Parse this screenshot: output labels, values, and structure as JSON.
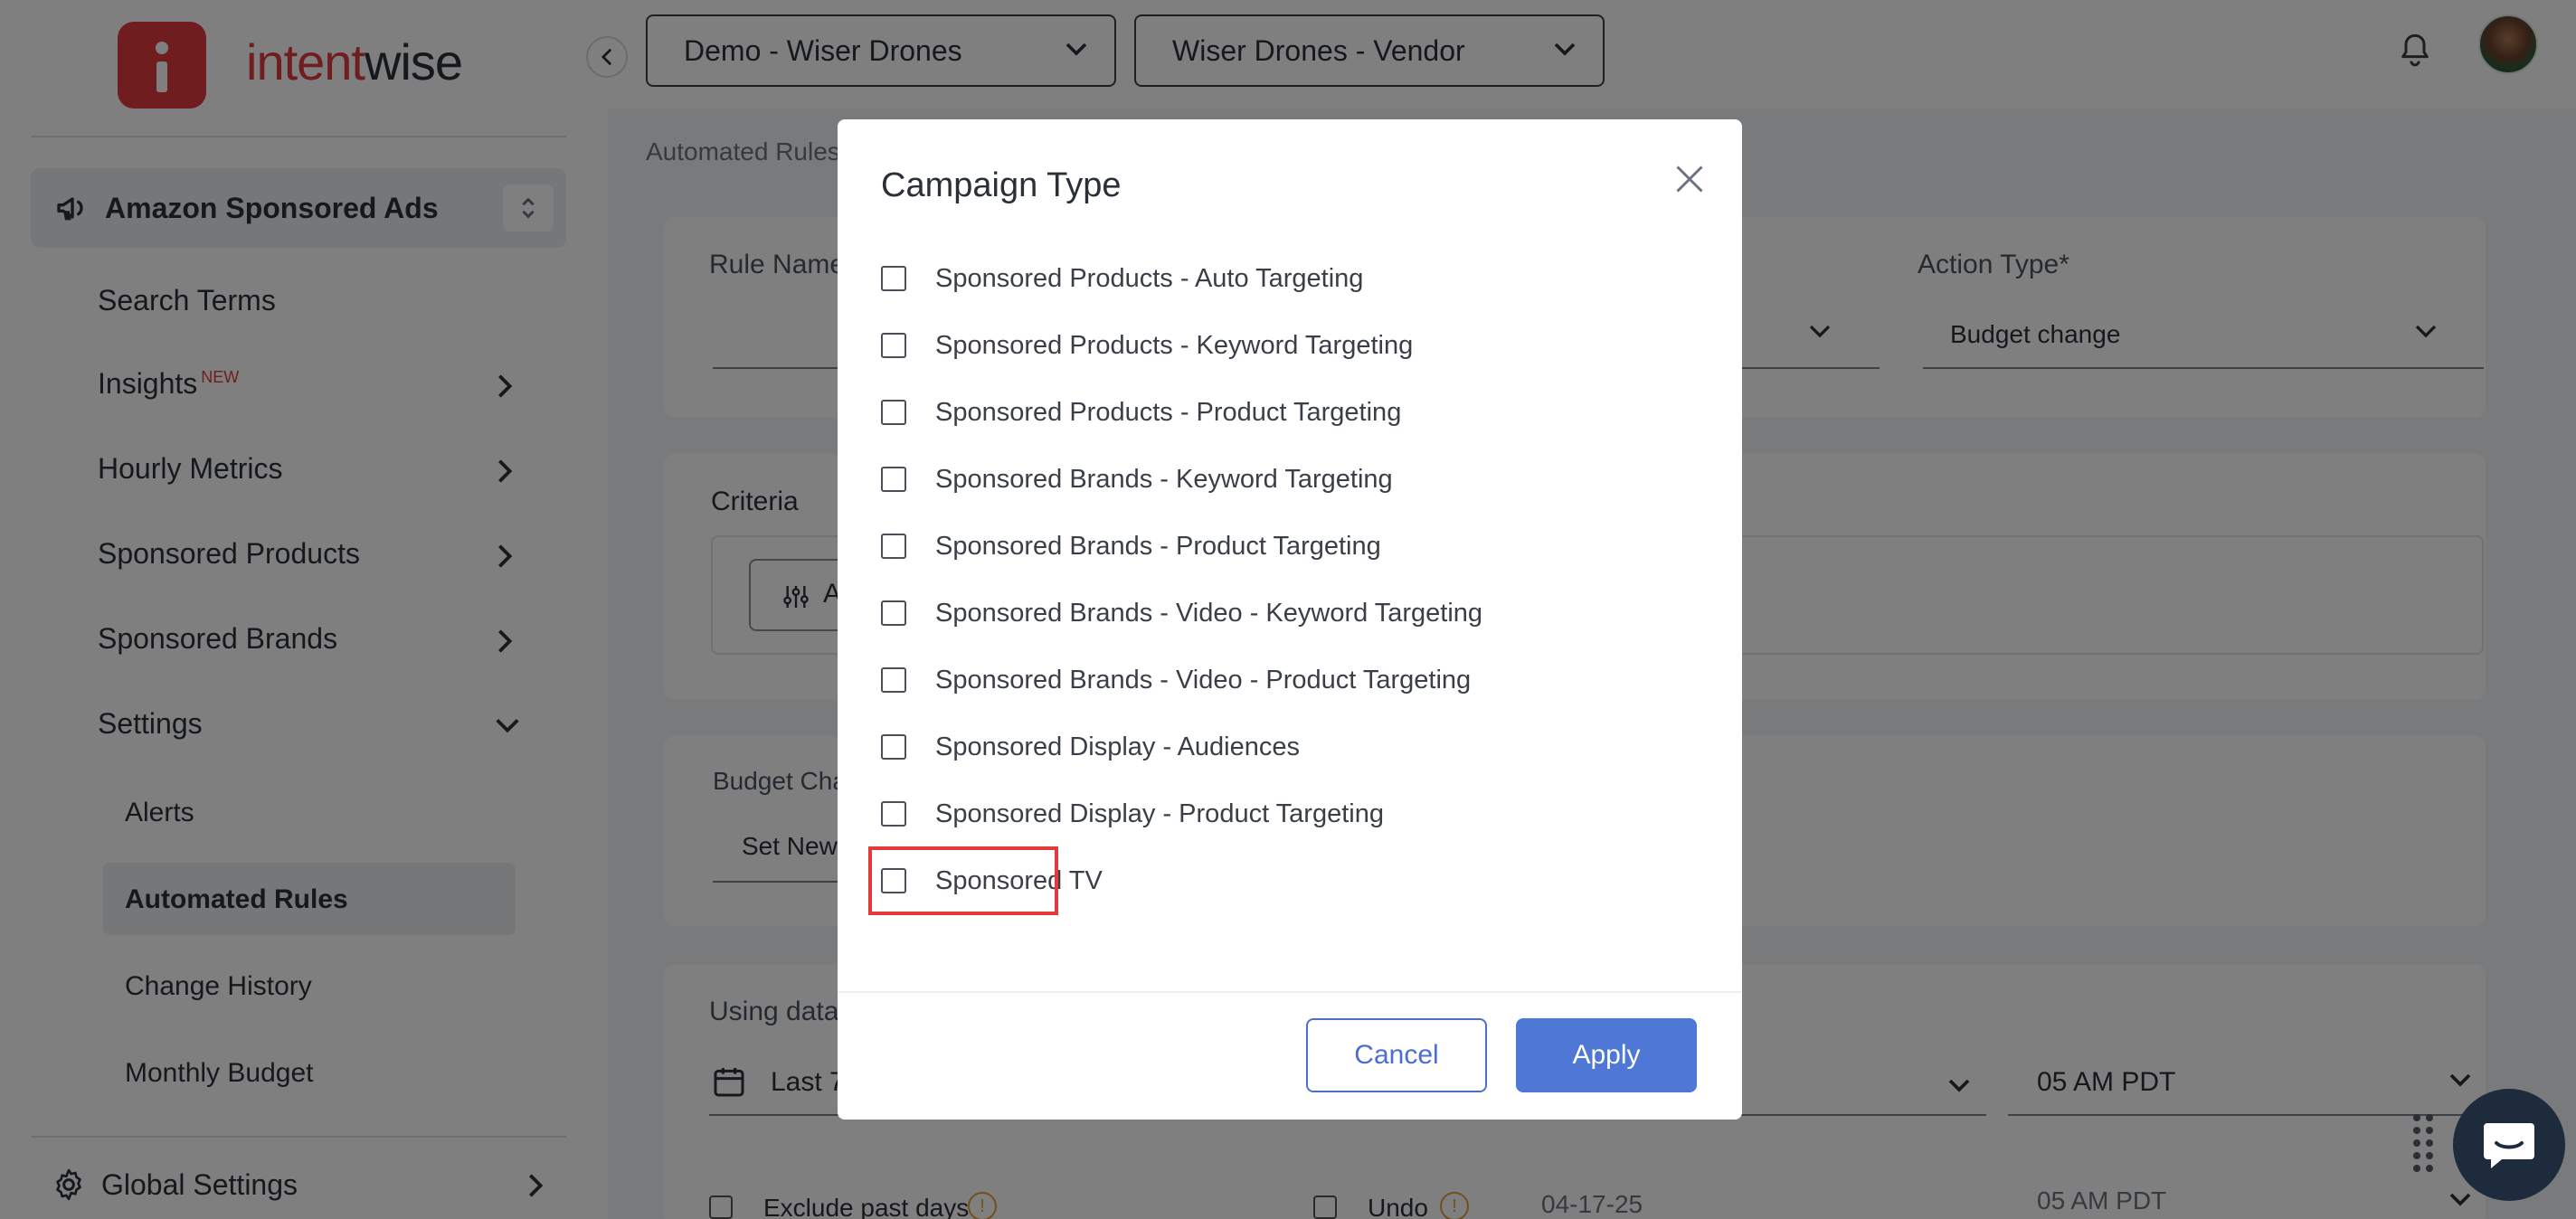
{
  "brand": {
    "logo_part_a": "intent",
    "logo_part_b": "wise",
    "accent": "#e03a3e"
  },
  "sidebar": {
    "product": "Amazon Sponsored Ads",
    "items": [
      {
        "label": "Search Terms"
      },
      {
        "label": "Insights",
        "badge": "NEW"
      },
      {
        "label": "Hourly Metrics"
      },
      {
        "label": "Sponsored Products"
      },
      {
        "label": "Sponsored Brands"
      },
      {
        "label": "Settings"
      }
    ],
    "settings_sub": [
      "Alerts",
      "Automated Rules",
      "Change History",
      "Monthly Budget"
    ],
    "active_sub": "Automated Rules",
    "global": "Global Settings"
  },
  "topbar": {
    "account": "Demo - Wiser Drones",
    "profile": "Wiser Drones - Vendor"
  },
  "page": {
    "breadcrumb": "Automated Rules",
    "rule_name_label": "Rule Name",
    "action_type_label": "Action Type*",
    "action_type_value": "Budget change",
    "criteria_label": "Criteria",
    "criteria_add": "A",
    "budget_label": "Budget Cha",
    "budget_value": "Set New",
    "using_data_label": "Using data",
    "range_value": "Last 7",
    "time_value": "05 AM PDT",
    "exclude_label": "Exclude past days",
    "undo_label": "Undo",
    "undo_date": "04-17-25",
    "undo_time": "05 AM PDT"
  },
  "modal": {
    "title": "Campaign Type",
    "options": [
      "Sponsored Products - Auto Targeting",
      "Sponsored Products - Keyword Targeting",
      "Sponsored Products - Product Targeting",
      "Sponsored Brands - Keyword Targeting",
      "Sponsored Brands - Product Targeting",
      "Sponsored Brands - Video - Keyword Targeting",
      "Sponsored Brands - Video - Product Targeting",
      "Sponsored Display - Audiences",
      "Sponsored Display - Product Targeting",
      "Sponsored TV"
    ],
    "cancel": "Cancel",
    "apply": "Apply"
  },
  "colors": {
    "primary": "#4f78d6",
    "highlight": "#e23b3b",
    "chat": "#1d2b3c"
  }
}
